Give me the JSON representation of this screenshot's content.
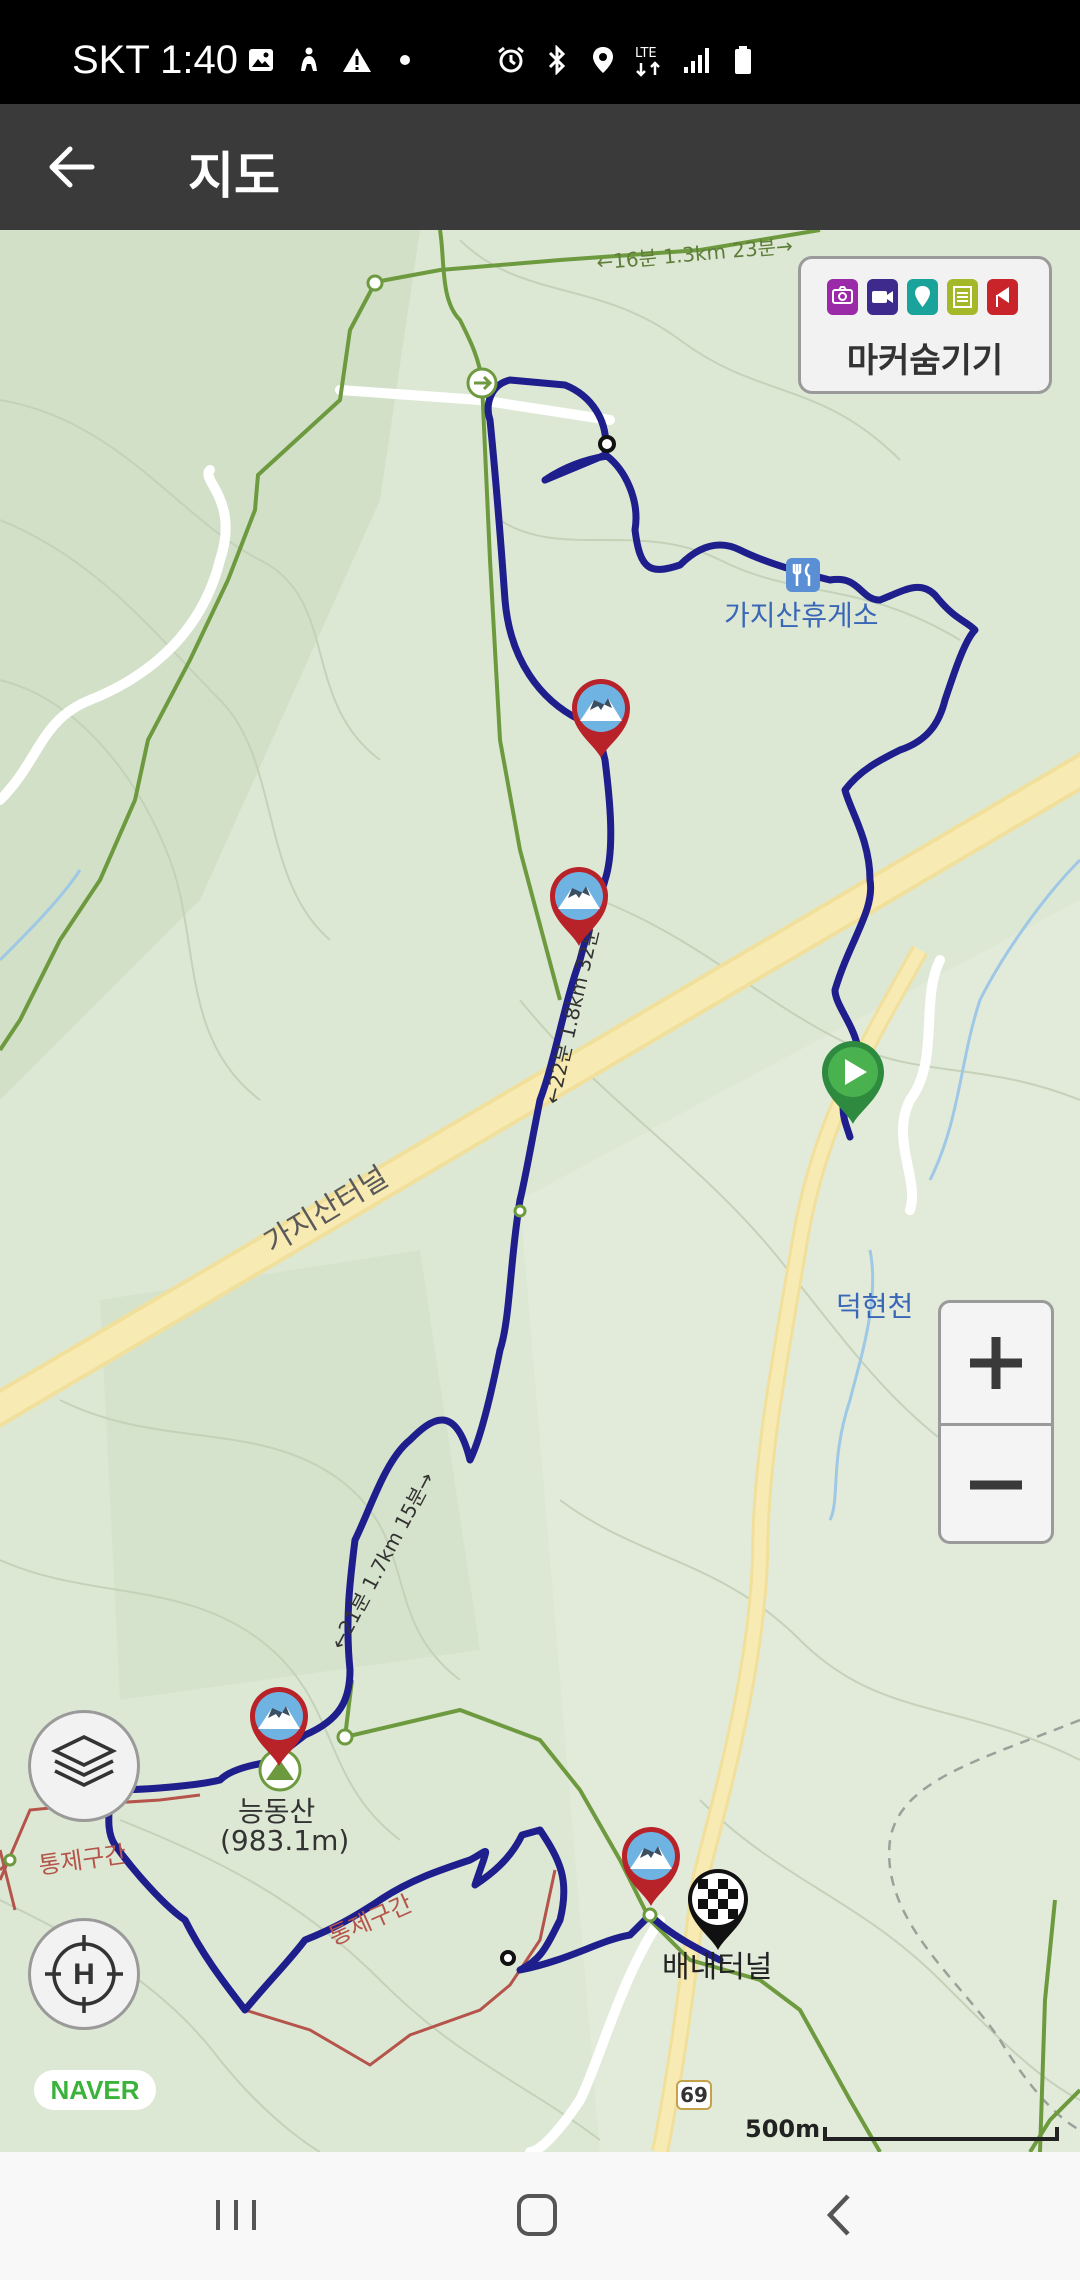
{
  "status_bar": {
    "carrier_time": "SKT 1:40",
    "network": "LTE"
  },
  "app_bar": {
    "title": "지도",
    "back_icon": "arrow-left-icon"
  },
  "map": {
    "places": {
      "rest_area": "가지산휴게소",
      "tunnel_main": "가지산터널",
      "stream": "덕현천",
      "peak_name": "능동산",
      "peak_height": "(983.1m)",
      "tunnel_end": "배내터널",
      "restricted_1": "통제구간",
      "restricted_2": "통제구간",
      "road_number": "69"
    },
    "segment_labels": {
      "top": "←16분 1.3km 23분→",
      "middle": "←22분 1.8km 32분→",
      "lower": "←21분 1.7km 15분→"
    },
    "marker_hide": {
      "label": "마커숨기기",
      "icons": [
        "camera-icon",
        "video-icon",
        "location-pin-icon",
        "notepad-icon",
        "flag-icon"
      ],
      "colors": [
        "#9b2aa8",
        "#3d2a8c",
        "#1aa39a",
        "#a4b82a",
        "#c8242a"
      ]
    },
    "zoom": {
      "plus": "+",
      "minus": "−"
    },
    "brand": "NAVER",
    "scale_label": "500m",
    "route_color": "#1e1e8c",
    "trail_color": "#6d9a3e",
    "restricted_color": "#b5544b",
    "highway_color": "#f5e6a6"
  },
  "nav_bar": {
    "recent_icon": "recent-apps-icon",
    "home_icon": "home-icon",
    "back_icon": "back-chevron-icon"
  }
}
